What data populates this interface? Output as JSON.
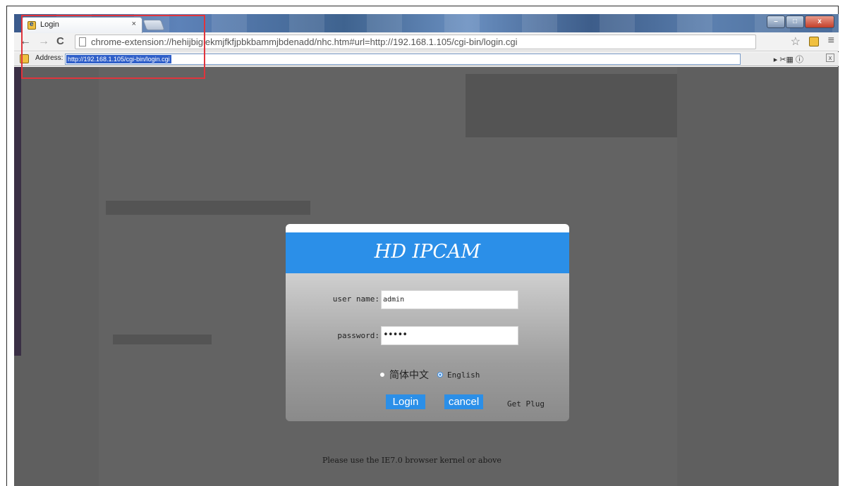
{
  "browser": {
    "tab": {
      "title": "Login",
      "close_symbol": "×"
    },
    "nav": {
      "back_icon": "←",
      "forward_icon": "→",
      "reload_icon": "C",
      "url": "chrome-extension://hehijbigiekmjfkfjpbkbammjbdenadd/nhc.htm#url=http://192.168.1.105/cgi-bin/login.cgi",
      "star_icon": "☆",
      "menu_icon": "≡"
    },
    "window_buttons": [
      "–",
      "□",
      "x"
    ],
    "address_bar": {
      "label": "Address:",
      "value": "http://192.168.1.105/cgi-bin/login.cgi",
      "tools": "▸ ✂▦ ⓘ",
      "close_symbol": "x"
    }
  },
  "login_dialog": {
    "title": "HD IPCAM",
    "username_label": "user name:",
    "username_value": "admin",
    "password_label": "password:",
    "password_value": "•••••",
    "language_options": [
      {
        "label": "简体中文",
        "selected": false
      },
      {
        "label": "English",
        "selected": true
      }
    ],
    "login_button": "Login",
    "cancel_button": "cancel",
    "plugin_link": "Get Plug"
  },
  "footer_notice": "Please use the IE7.0 browser kernel or above",
  "colors": {
    "header_blue": "#2b8fe8",
    "highlight_box": "#e0343c",
    "page_background": "#5f5f5f"
  }
}
